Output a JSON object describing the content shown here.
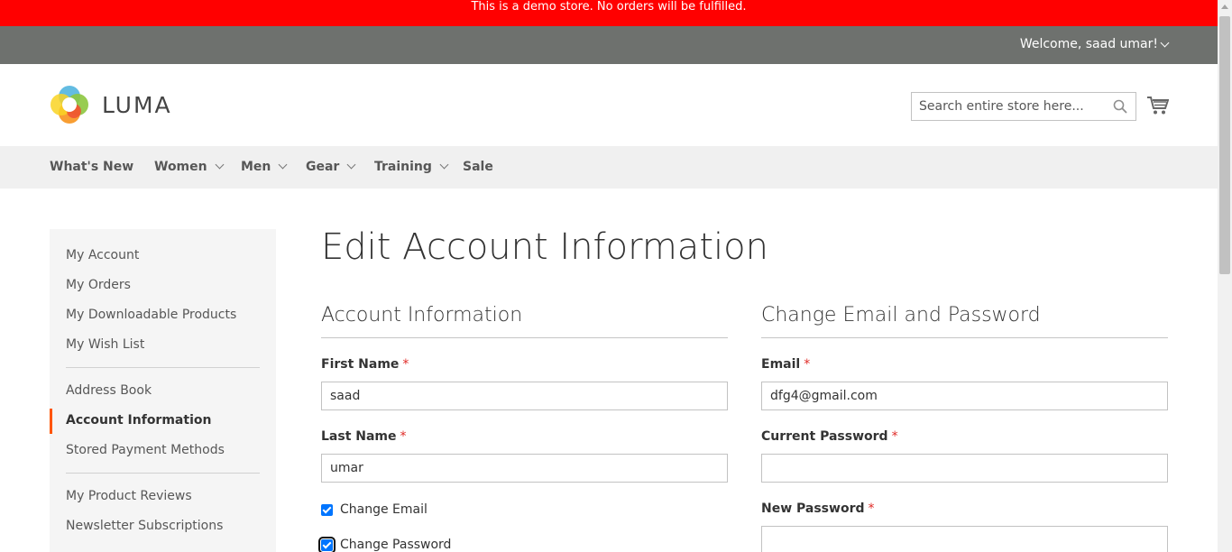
{
  "demo_notice": "This is a demo store. No orders will be fulfilled.",
  "welcome": "Welcome, saad umar!",
  "logo_text": "LUMA",
  "search": {
    "placeholder": "Search entire store here..."
  },
  "nav": [
    "What's New",
    "Women",
    "Men",
    "Gear",
    "Training",
    "Sale"
  ],
  "sidebar": {
    "items": [
      "My Account",
      "My Orders",
      "My Downloadable Products",
      "My Wish List",
      "Address Book",
      "Account Information",
      "Stored Payment Methods",
      "My Product Reviews",
      "Newsletter Subscriptions"
    ],
    "active": "Account Information"
  },
  "page_title": "Edit Account Information",
  "account_info": {
    "title": "Account Information",
    "first_name_label": "First Name",
    "first_name_value": "saad",
    "last_name_label": "Last Name",
    "last_name_value": "umar",
    "change_email_label": "Change Email",
    "change_password_label": "Change Password"
  },
  "change_section": {
    "title": "Change Email and Password",
    "email_label": "Email",
    "email_value": "dfg4@gmail.com",
    "current_password_label": "Current Password",
    "new_password_label": "New Password"
  },
  "required_mark": "*",
  "colors": {
    "demo_bar": "#ff0000",
    "welcome_bar": "#6e716e",
    "nav_bg": "#f0f0f0",
    "accent": "#ff5501",
    "required": "#e02b27",
    "checkbox": "#0075ff"
  }
}
